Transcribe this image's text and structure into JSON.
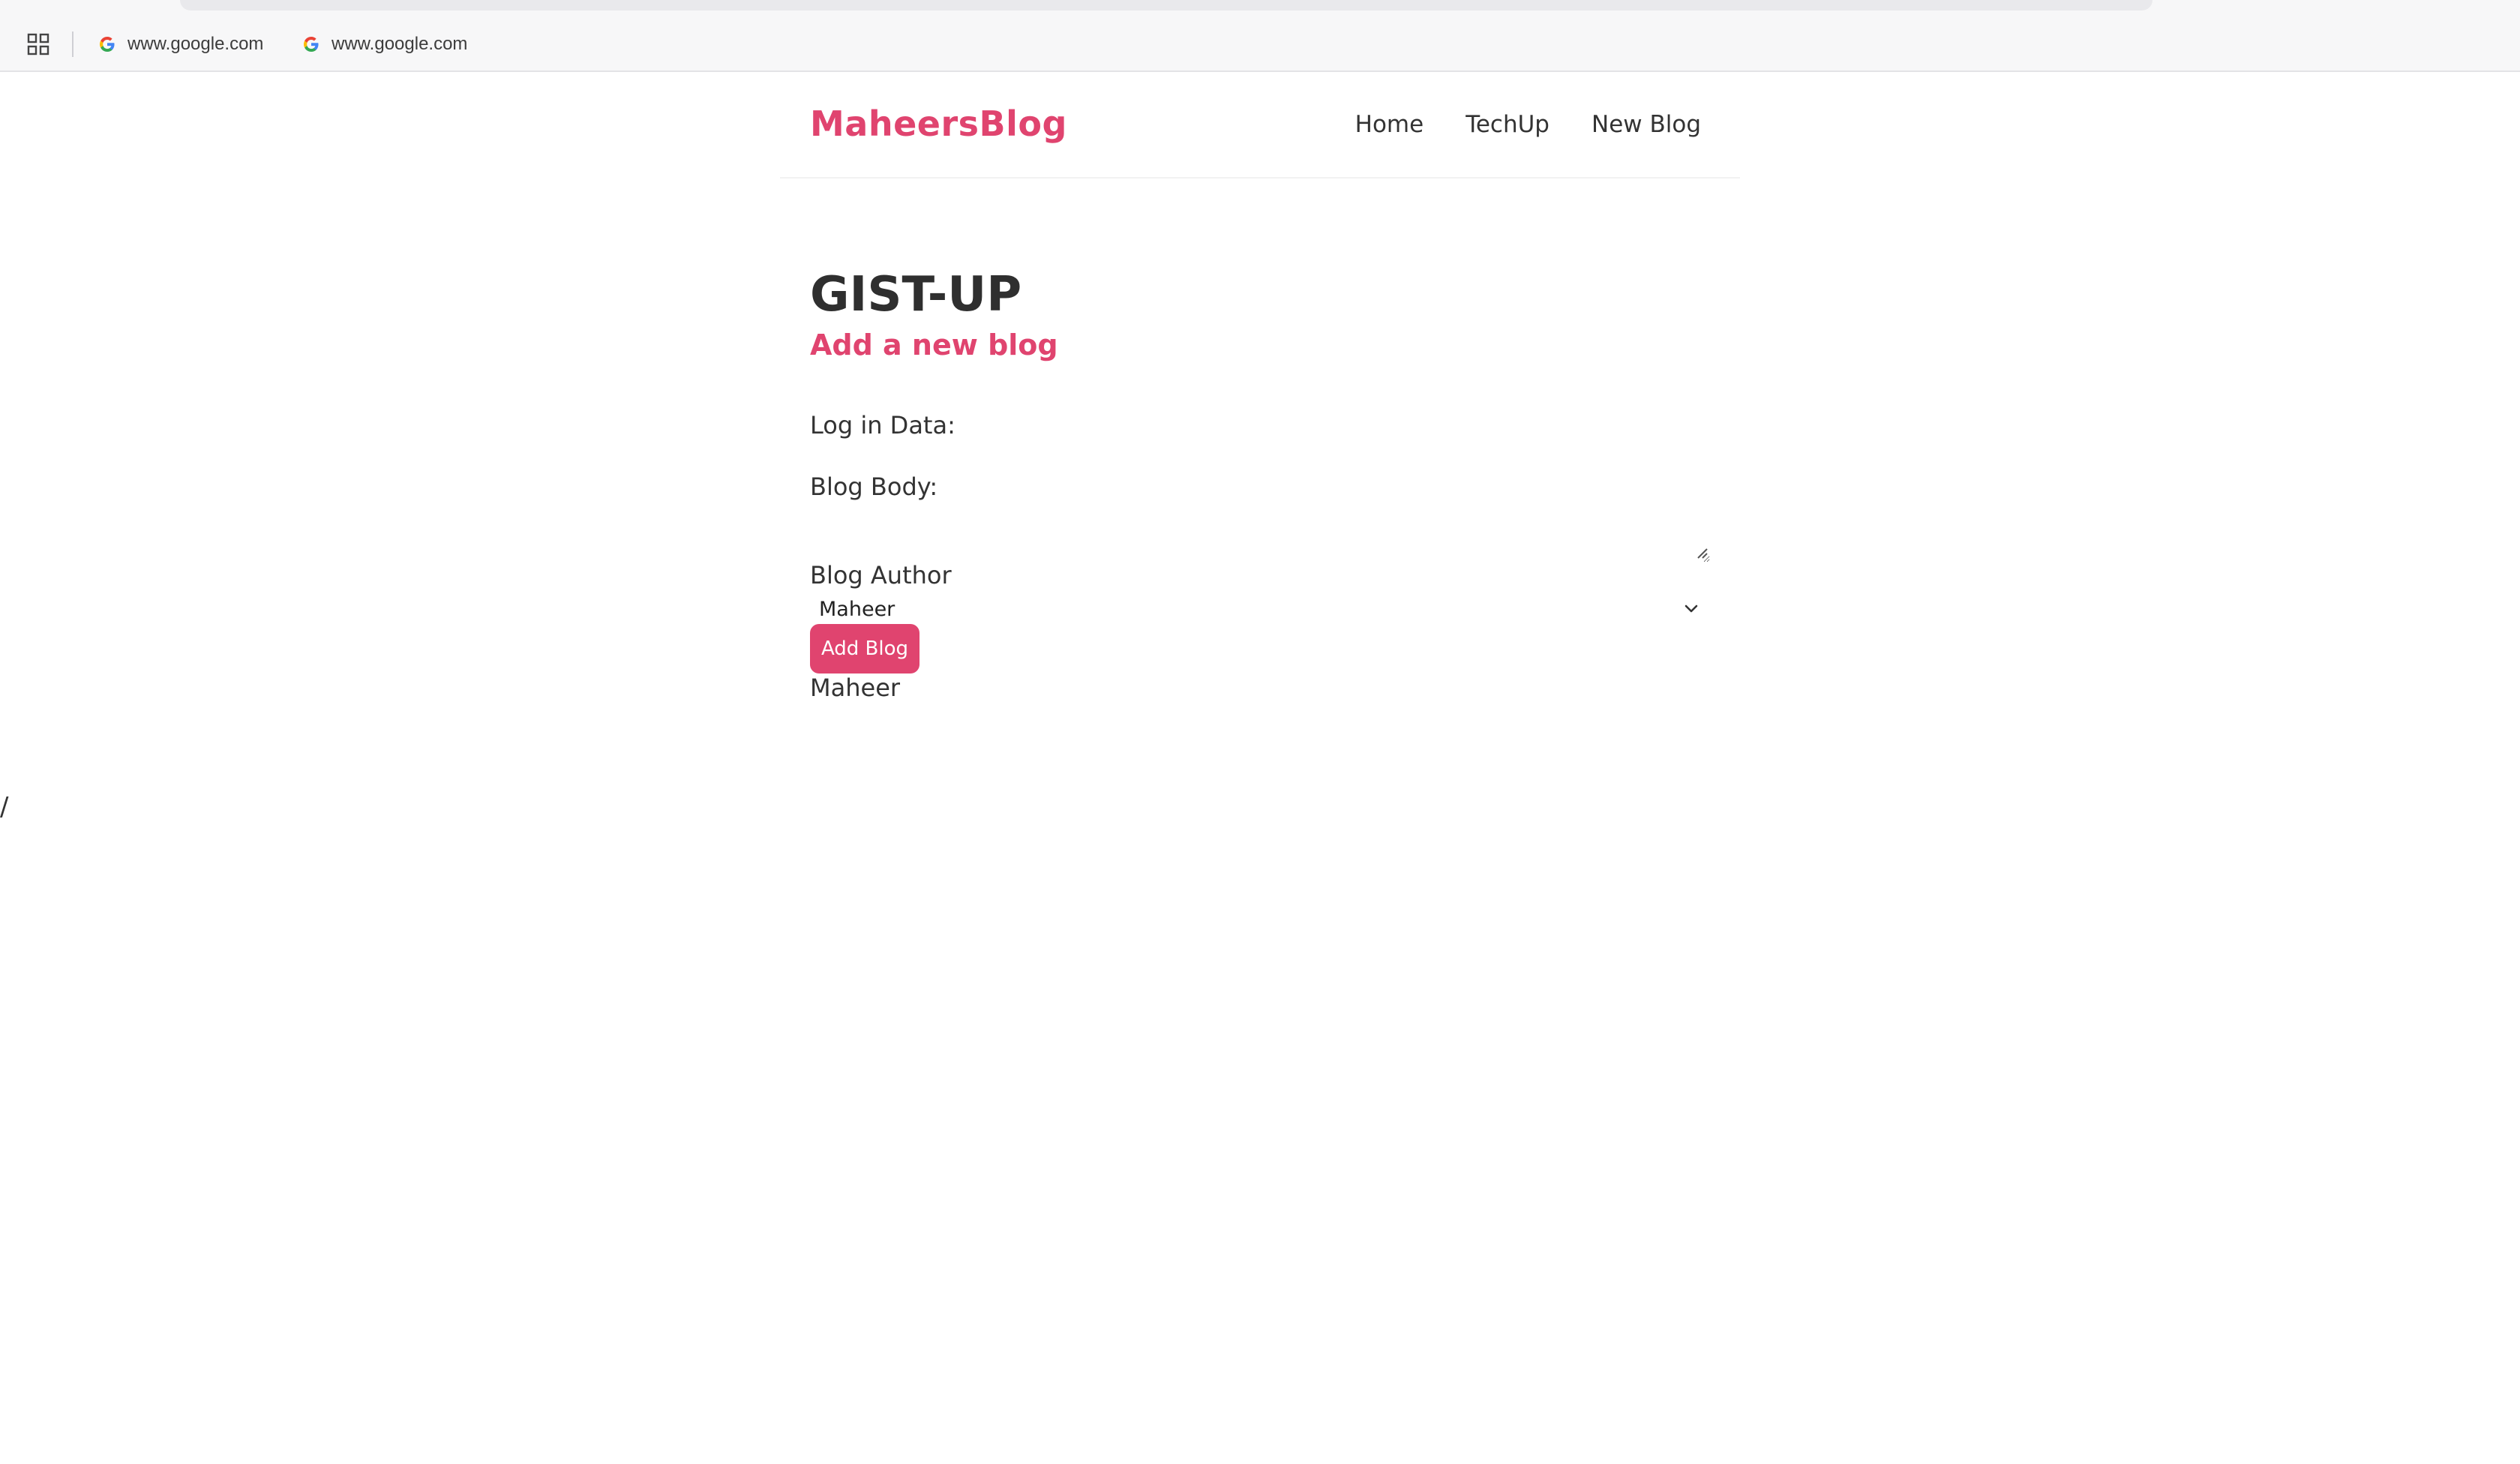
{
  "browser": {
    "bookmarks": [
      {
        "label": "www.google.com",
        "icon": "google-icon"
      },
      {
        "label": "www.google.com",
        "icon": "google-icon"
      }
    ]
  },
  "navbar": {
    "brand": "MaheersBlog",
    "links": [
      "Home",
      "TechUp",
      "New Blog"
    ]
  },
  "main": {
    "title": "GIST-UP",
    "subtitle": "Add a new blog",
    "login_label": "Log in Data:",
    "body_label": "Blog Body:",
    "body_value": "",
    "author_label": "Blog Author",
    "author_selected": "Maheer",
    "submit_label": "Add Blog",
    "preview_author": "Maheer"
  },
  "stray_text": "/",
  "colors": {
    "accent": "#e0446f",
    "text": "#333333",
    "chrome_bg": "#f7f7f8"
  }
}
